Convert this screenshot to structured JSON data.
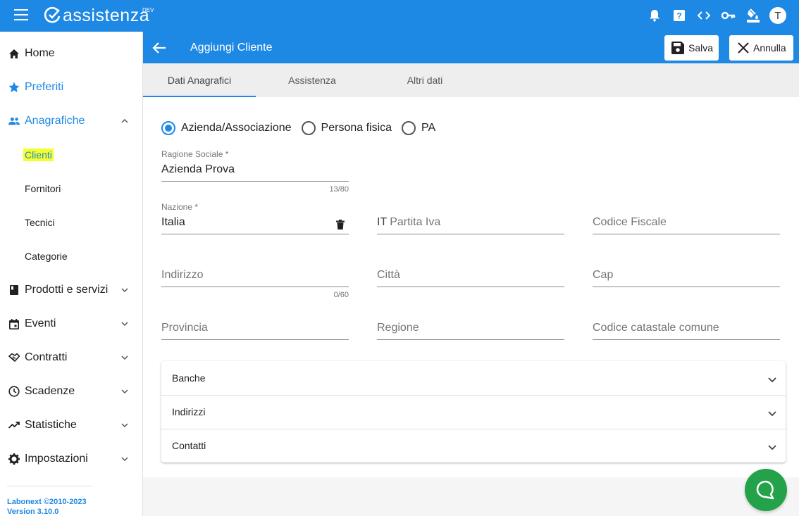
{
  "app": {
    "logo_text": "assistenza",
    "env_badge": "DEV",
    "avatar_initial": "T",
    "accent_color": "#1e88e5",
    "top_icons": [
      "bell-icon",
      "help-icon",
      "code-icon",
      "key-icon",
      "paint-bucket-icon"
    ]
  },
  "sidebar": {
    "items": [
      {
        "label": "Home",
        "icon": "home-icon"
      },
      {
        "label": "Preferiti",
        "icon": "star-icon"
      },
      {
        "label": "Anagrafiche",
        "icon": "people-icon",
        "expanded": true
      },
      {
        "label": "Clienti",
        "sub": true,
        "highlighted": true
      },
      {
        "label": "Fornitori",
        "sub": true
      },
      {
        "label": "Tecnici",
        "sub": true
      },
      {
        "label": "Categorie",
        "sub": true
      },
      {
        "label": "Prodotti e servizi",
        "icon": "book-icon"
      },
      {
        "label": "Eventi",
        "icon": "calendar-icon"
      },
      {
        "label": "Contratti",
        "icon": "handshake-icon"
      },
      {
        "label": "Scadenze",
        "icon": "clock-icon"
      },
      {
        "label": "Statistiche",
        "icon": "trending-up-icon"
      },
      {
        "label": "Impostazioni",
        "icon": "gear-icon"
      }
    ],
    "footer": {
      "line1": "Labonext ©2010-2023",
      "line2": "Version 3.10.0"
    }
  },
  "header": {
    "title": "Aggiungi Cliente",
    "save_label": "Salva",
    "cancel_label": "Annulla"
  },
  "tabs": [
    {
      "label": "Dati Anagrafici",
      "active": true
    },
    {
      "label": "Assistenza"
    },
    {
      "label": "Altri dati"
    }
  ],
  "form": {
    "type_options": [
      "Azienda/Associazione",
      "Persona fisica",
      "PA"
    ],
    "type_selected": "Azienda/Associazione",
    "ragione_sociale": {
      "label": "Ragione Sociale *",
      "value": "Azienda Prova",
      "counter": "13/80"
    },
    "nazione": {
      "label": "Nazione *",
      "value": "Italia"
    },
    "partita_iva": {
      "prefix": "IT",
      "placeholder": "Partita Iva"
    },
    "codice_fiscale": {
      "placeholder": "Codice Fiscale"
    },
    "indirizzo": {
      "placeholder": "Indirizzo",
      "counter": "0/60"
    },
    "citta": {
      "placeholder": "Città"
    },
    "cap": {
      "placeholder": "Cap"
    },
    "provincia": {
      "placeholder": "Provincia"
    },
    "regione": {
      "placeholder": "Regione"
    },
    "codice_catastale": {
      "placeholder": "Codice catastale comune"
    }
  },
  "accordion": [
    {
      "label": "Banche"
    },
    {
      "label": "Indirizzi"
    },
    {
      "label": "Contatti"
    }
  ],
  "chat": {
    "icon": "chat-bubble-icon",
    "color": "#23a249"
  }
}
